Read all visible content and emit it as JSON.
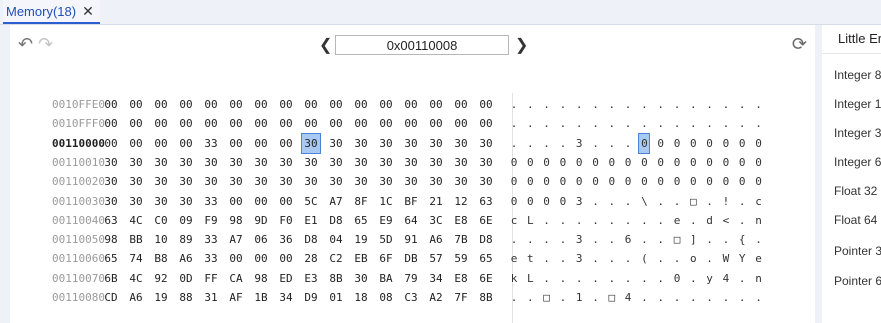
{
  "tab": {
    "label": "Memory(18)",
    "close": "✕"
  },
  "toolbar": {
    "address_value": "0x00110008"
  },
  "selected": {
    "row": 2,
    "col": 8
  },
  "rows": [
    {
      "addr": "0010FFE0",
      "bytes": [
        "00",
        "00",
        "00",
        "00",
        "00",
        "00",
        "00",
        "00",
        "00",
        "00",
        "00",
        "00",
        "00",
        "00",
        "00",
        "00"
      ],
      "ascii": [
        ".",
        ".",
        ".",
        ".",
        ".",
        ".",
        ".",
        ".",
        ".",
        ".",
        ".",
        ".",
        ".",
        ".",
        ".",
        "."
      ]
    },
    {
      "addr": "0010FFF0",
      "bytes": [
        "00",
        "00",
        "00",
        "00",
        "00",
        "00",
        "00",
        "00",
        "00",
        "00",
        "00",
        "00",
        "00",
        "00",
        "00",
        "00"
      ],
      "ascii": [
        ".",
        ".",
        ".",
        ".",
        ".",
        ".",
        ".",
        ".",
        ".",
        ".",
        ".",
        ".",
        ".",
        ".",
        ".",
        "."
      ]
    },
    {
      "addr": "00110000",
      "bytes": [
        "00",
        "00",
        "00",
        "00",
        "33",
        "00",
        "00",
        "00",
        "30",
        "30",
        "30",
        "30",
        "30",
        "30",
        "30",
        "30"
      ],
      "ascii": [
        ".",
        ".",
        ".",
        ".",
        "3",
        ".",
        ".",
        ".",
        "0",
        "0",
        "0",
        "0",
        "0",
        "0",
        "0",
        "0"
      ]
    },
    {
      "addr": "00110010",
      "bytes": [
        "30",
        "30",
        "30",
        "30",
        "30",
        "30",
        "30",
        "30",
        "30",
        "30",
        "30",
        "30",
        "30",
        "30",
        "30",
        "30"
      ],
      "ascii": [
        "0",
        "0",
        "0",
        "0",
        "0",
        "0",
        "0",
        "0",
        "0",
        "0",
        "0",
        "0",
        "0",
        "0",
        "0",
        "0"
      ]
    },
    {
      "addr": "00110020",
      "bytes": [
        "30",
        "30",
        "30",
        "30",
        "30",
        "30",
        "30",
        "30",
        "30",
        "30",
        "30",
        "30",
        "30",
        "30",
        "30",
        "30"
      ],
      "ascii": [
        "0",
        "0",
        "0",
        "0",
        "0",
        "0",
        "0",
        "0",
        "0",
        "0",
        "0",
        "0",
        "0",
        "0",
        "0",
        "0"
      ]
    },
    {
      "addr": "00110030",
      "bytes": [
        "30",
        "30",
        "30",
        "30",
        "33",
        "00",
        "00",
        "00",
        "5C",
        "A7",
        "8F",
        "1C",
        "BF",
        "21",
        "12",
        "63"
      ],
      "ascii": [
        "0",
        "0",
        "0",
        "0",
        "3",
        ".",
        ".",
        ".",
        "\\",
        ".",
        ".",
        "□",
        ".",
        "!",
        ".",
        "c"
      ]
    },
    {
      "addr": "00110040",
      "bytes": [
        "63",
        "4C",
        "C0",
        "09",
        "F9",
        "98",
        "9D",
        "F0",
        "E1",
        "D8",
        "65",
        "E9",
        "64",
        "3C",
        "E8",
        "6E"
      ],
      "ascii": [
        "c",
        "L",
        ".",
        ".",
        ".",
        ".",
        ".",
        ".",
        ".",
        ".",
        "e",
        ".",
        "d",
        "<",
        ".",
        "n"
      ]
    },
    {
      "addr": "00110050",
      "bytes": [
        "98",
        "BB",
        "10",
        "89",
        "33",
        "A7",
        "06",
        "36",
        "D8",
        "04",
        "19",
        "5D",
        "91",
        "A6",
        "7B",
        "D8"
      ],
      "ascii": [
        ".",
        ".",
        ".",
        ".",
        "3",
        ".",
        ".",
        "6",
        ".",
        ".",
        "□",
        "]",
        ".",
        ".",
        "{",
        "."
      ]
    },
    {
      "addr": "00110060",
      "bytes": [
        "65",
        "74",
        "B8",
        "A6",
        "33",
        "00",
        "00",
        "00",
        "28",
        "C2",
        "EB",
        "6F",
        "DB",
        "57",
        "59",
        "65"
      ],
      "ascii": [
        "e",
        "t",
        ".",
        ".",
        "3",
        ".",
        ".",
        ".",
        "(",
        ".",
        ".",
        "o",
        ".",
        "W",
        "Y",
        "e"
      ]
    },
    {
      "addr": "00110070",
      "bytes": [
        "6B",
        "4C",
        "92",
        "0D",
        "FF",
        "CA",
        "98",
        "ED",
        "E3",
        "8B",
        "30",
        "BA",
        "79",
        "34",
        "E8",
        "6E"
      ],
      "ascii": [
        "k",
        "L",
        ".",
        ".",
        ".",
        ".",
        ".",
        ".",
        ".",
        ".",
        "0",
        ".",
        "y",
        "4",
        ".",
        "n"
      ]
    },
    {
      "addr": "00110080",
      "bytes": [
        "CD",
        "A6",
        "19",
        "88",
        "31",
        "AF",
        "1B",
        "34",
        "D9",
        "01",
        "18",
        "08",
        "C3",
        "A2",
        "7F",
        "8B"
      ],
      "ascii": [
        ".",
        ".",
        "□",
        ".",
        "1",
        ".",
        "□",
        "4",
        ".",
        ".",
        ".",
        ".",
        ".",
        ".",
        ".",
        "."
      ]
    }
  ],
  "right_panel": {
    "header": "Little Er",
    "items": [
      "Integer 8",
      "Integer 1",
      "Integer 3",
      "Integer 6",
      "Float 32",
      "Float 64",
      "Pointer 3",
      "Pointer 6"
    ]
  }
}
